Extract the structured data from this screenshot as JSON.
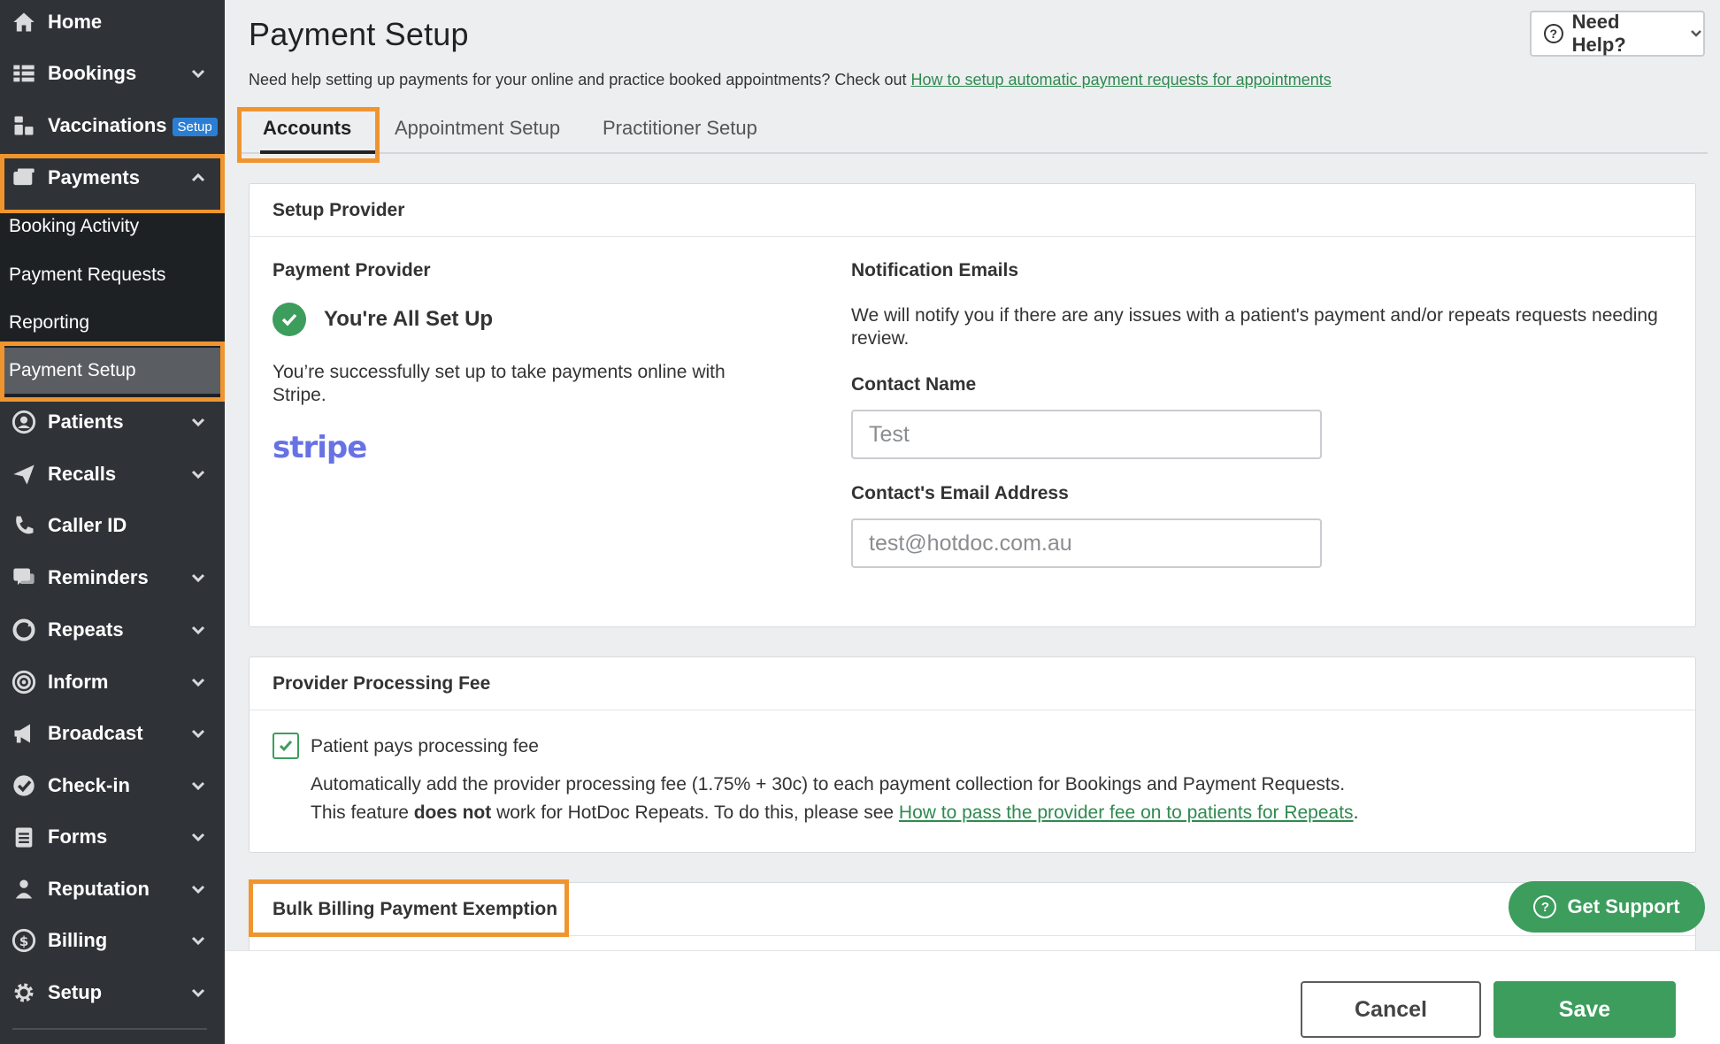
{
  "sidebar": {
    "items": [
      {
        "label": "Home",
        "icon": "home-icon"
      },
      {
        "label": "Bookings",
        "icon": "bookings-icon"
      },
      {
        "label": "Vaccinations",
        "badge": "Setup",
        "icon": "vaccinations-icon"
      },
      {
        "label": "Payments",
        "icon": "payments-icon"
      },
      {
        "label": "Patients",
        "icon": "patients-icon"
      },
      {
        "label": "Recalls",
        "icon": "recalls-icon"
      },
      {
        "label": "Caller ID",
        "icon": "caller-id-icon"
      },
      {
        "label": "Reminders",
        "icon": "reminders-icon"
      },
      {
        "label": "Repeats",
        "icon": "repeats-icon"
      },
      {
        "label": "Inform",
        "icon": "inform-icon"
      },
      {
        "label": "Broadcast",
        "icon": "broadcast-icon"
      },
      {
        "label": "Check-in",
        "icon": "check-in-icon"
      },
      {
        "label": "Forms",
        "icon": "forms-icon"
      },
      {
        "label": "Reputation",
        "icon": "reputation-icon"
      },
      {
        "label": "Billing",
        "icon": "billing-icon"
      },
      {
        "label": "Setup",
        "icon": "setup-icon"
      }
    ],
    "payments_sub": [
      {
        "label": "Booking Activity"
      },
      {
        "label": "Payment Requests"
      },
      {
        "label": "Reporting"
      },
      {
        "label": "Payment Setup"
      }
    ]
  },
  "header": {
    "title": "Payment Setup",
    "help_label": "Need Help?",
    "intro_text": "Need help setting up payments for your online and practice booked appointments? Check out ",
    "intro_link": "How to setup automatic payment requests for appointments"
  },
  "tabs": [
    {
      "label": "Accounts",
      "active": true
    },
    {
      "label": "Appointment Setup",
      "active": false
    },
    {
      "label": "Practitioner Setup",
      "active": false
    }
  ],
  "setup_provider": {
    "heading": "Setup Provider",
    "provider_label": "Payment Provider",
    "status": "You're All Set Up",
    "description": "You’re successfully set up to take payments online with Stripe.",
    "provider_logo": "stripe",
    "notification_label": "Notification Emails",
    "notification_text": "We will notify you if there are any issues with a patient's payment and/or repeats requests needing review.",
    "contact_name_label": "Contact Name",
    "contact_name_value": "Test",
    "contact_email_label": "Contact's Email Address",
    "contact_email_value": "test@hotdoc.com.au"
  },
  "processing_fee": {
    "heading": "Provider Processing Fee",
    "checkbox_label": "Patient pays processing fee",
    "checked": true,
    "line1": "Automatically add the provider processing fee (1.75% + 30c) to each payment collection for Bookings and Payment Requests.",
    "line2_pre": "This feature ",
    "line2_bold": "does not",
    "line2_mid": " work for HotDoc Repeats. To do this, please see ",
    "line2_link": "How to pass the provider fee on to patients for Repeats",
    "line2_end": "."
  },
  "bulk_billing": {
    "heading": "Bulk Billing Payment Exemption"
  },
  "support_label": "Get Support",
  "footer": {
    "cancel_label": "Cancel",
    "save_label": "Save"
  },
  "colors": {
    "sidebar_bg": "#2f3337",
    "accent_green": "#3c9d5d",
    "highlight_orange": "#f0952e",
    "badge_blue": "#2a7fd4",
    "stripe_purple": "#6772e5"
  }
}
